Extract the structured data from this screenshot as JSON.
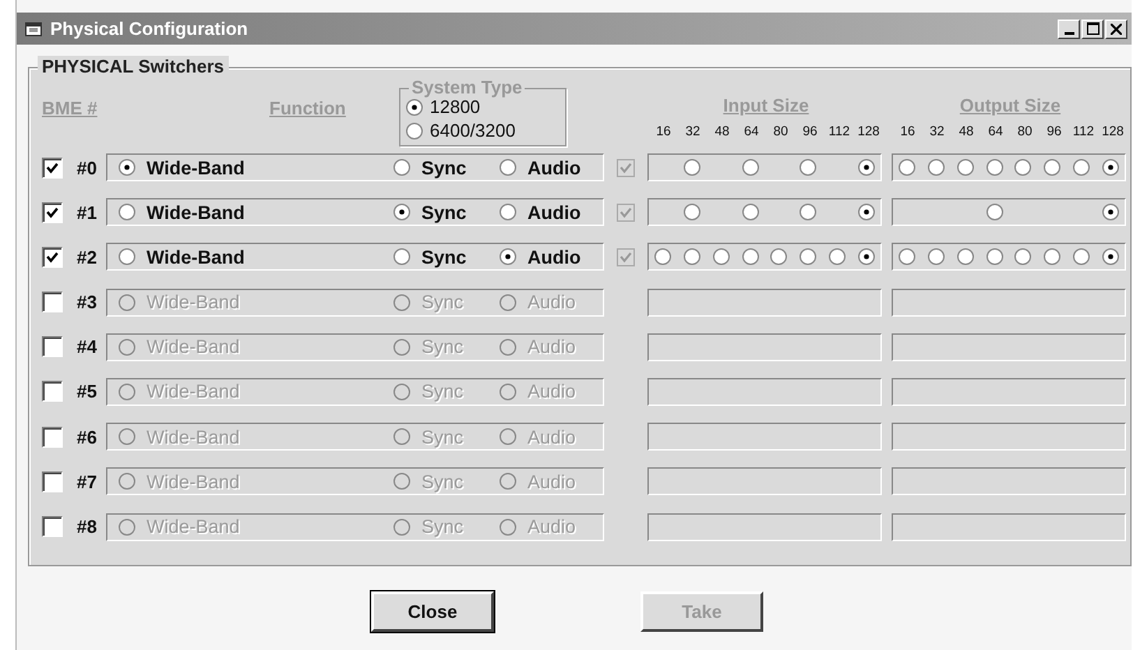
{
  "window": {
    "title": "Physical Configuration"
  },
  "group": {
    "title": "PHYSICAL Switchers"
  },
  "headers": {
    "bme": "BME #",
    "function": "Function",
    "system_type": {
      "title": "System Type",
      "options": [
        {
          "label": "12800",
          "selected": true
        },
        {
          "label": "6400/3200",
          "selected": false
        }
      ]
    },
    "input_size": {
      "title": "Input Size",
      "ticks": [
        "16",
        "32",
        "48",
        "64",
        "80",
        "96",
        "112",
        "128"
      ]
    },
    "output_size": {
      "title": "Output Size",
      "ticks": [
        "16",
        "32",
        "48",
        "64",
        "80",
        "96",
        "112",
        "128"
      ]
    }
  },
  "rows": [
    {
      "number": "#0",
      "checked": true,
      "enabled": true,
      "options": [
        {
          "label": "Wide-Band",
          "selected": true
        },
        {
          "label": "Sync",
          "selected": false
        },
        {
          "label": "Audio",
          "selected": false
        }
      ],
      "aux_checked": true,
      "input": [
        {
          "kind": "empty"
        },
        {
          "kind": "radio",
          "selected": false
        },
        {
          "kind": "empty"
        },
        {
          "kind": "radio",
          "selected": false
        },
        {
          "kind": "empty"
        },
        {
          "kind": "radio",
          "selected": false
        },
        {
          "kind": "empty"
        },
        {
          "kind": "radio",
          "selected": true
        }
      ],
      "output": [
        {
          "kind": "radio",
          "selected": false
        },
        {
          "kind": "radio",
          "selected": false
        },
        {
          "kind": "radio",
          "selected": false
        },
        {
          "kind": "radio",
          "selected": false
        },
        {
          "kind": "radio",
          "selected": false
        },
        {
          "kind": "radio",
          "selected": false
        },
        {
          "kind": "radio",
          "selected": false
        },
        {
          "kind": "radio",
          "selected": true
        }
      ]
    },
    {
      "number": "#1",
      "checked": true,
      "enabled": true,
      "options": [
        {
          "label": "Wide-Band",
          "selected": false
        },
        {
          "label": "Sync",
          "selected": true
        },
        {
          "label": "Audio",
          "selected": false
        }
      ],
      "aux_checked": true,
      "input": [
        {
          "kind": "empty"
        },
        {
          "kind": "radio",
          "selected": false
        },
        {
          "kind": "empty"
        },
        {
          "kind": "radio",
          "selected": false
        },
        {
          "kind": "empty"
        },
        {
          "kind": "radio",
          "selected": false
        },
        {
          "kind": "empty"
        },
        {
          "kind": "radio",
          "selected": true
        }
      ],
      "output": [
        {
          "kind": "empty"
        },
        {
          "kind": "empty"
        },
        {
          "kind": "empty"
        },
        {
          "kind": "radio",
          "selected": false
        },
        {
          "kind": "empty"
        },
        {
          "kind": "empty"
        },
        {
          "kind": "empty"
        },
        {
          "kind": "radio",
          "selected": true
        }
      ]
    },
    {
      "number": "#2",
      "checked": true,
      "enabled": true,
      "options": [
        {
          "label": "Wide-Band",
          "selected": false
        },
        {
          "label": "Sync",
          "selected": false
        },
        {
          "label": "Audio",
          "selected": true
        }
      ],
      "aux_checked": true,
      "input": [
        {
          "kind": "radio",
          "selected": false
        },
        {
          "kind": "radio",
          "selected": false
        },
        {
          "kind": "radio",
          "selected": false
        },
        {
          "kind": "radio",
          "selected": false
        },
        {
          "kind": "radio",
          "selected": false
        },
        {
          "kind": "radio",
          "selected": false
        },
        {
          "kind": "radio",
          "selected": false
        },
        {
          "kind": "radio",
          "selected": true
        }
      ],
      "output": [
        {
          "kind": "radio",
          "selected": false
        },
        {
          "kind": "radio",
          "selected": false
        },
        {
          "kind": "radio",
          "selected": false
        },
        {
          "kind": "radio",
          "selected": false
        },
        {
          "kind": "radio",
          "selected": false
        },
        {
          "kind": "radio",
          "selected": false
        },
        {
          "kind": "radio",
          "selected": false
        },
        {
          "kind": "radio",
          "selected": true
        }
      ]
    },
    {
      "number": "#3",
      "checked": false,
      "enabled": false,
      "options": [
        {
          "label": "Wide-Band",
          "selected": false
        },
        {
          "label": "Sync",
          "selected": false
        },
        {
          "label": "Audio",
          "selected": false
        }
      ]
    },
    {
      "number": "#4",
      "checked": false,
      "enabled": false,
      "options": [
        {
          "label": "Wide-Band",
          "selected": false
        },
        {
          "label": "Sync",
          "selected": false
        },
        {
          "label": "Audio",
          "selected": false
        }
      ]
    },
    {
      "number": "#5",
      "checked": false,
      "enabled": false,
      "options": [
        {
          "label": "Wide-Band",
          "selected": false
        },
        {
          "label": "Sync",
          "selected": false
        },
        {
          "label": "Audio",
          "selected": false
        }
      ]
    },
    {
      "number": "#6",
      "checked": false,
      "enabled": false,
      "options": [
        {
          "label": "Wide-Band",
          "selected": false
        },
        {
          "label": "Sync",
          "selected": false
        },
        {
          "label": "Audio",
          "selected": false
        }
      ]
    },
    {
      "number": "#7",
      "checked": false,
      "enabled": false,
      "options": [
        {
          "label": "Wide-Band",
          "selected": false
        },
        {
          "label": "Sync",
          "selected": false
        },
        {
          "label": "Audio",
          "selected": false
        }
      ]
    },
    {
      "number": "#8",
      "checked": false,
      "enabled": false,
      "options": [
        {
          "label": "Wide-Band",
          "selected": false
        },
        {
          "label": "Sync",
          "selected": false
        },
        {
          "label": "Audio",
          "selected": false
        }
      ]
    }
  ],
  "buttons": [
    {
      "label": "Close",
      "default": true,
      "disabled": false
    },
    {
      "label": "Take",
      "default": false,
      "disabled": true
    }
  ]
}
